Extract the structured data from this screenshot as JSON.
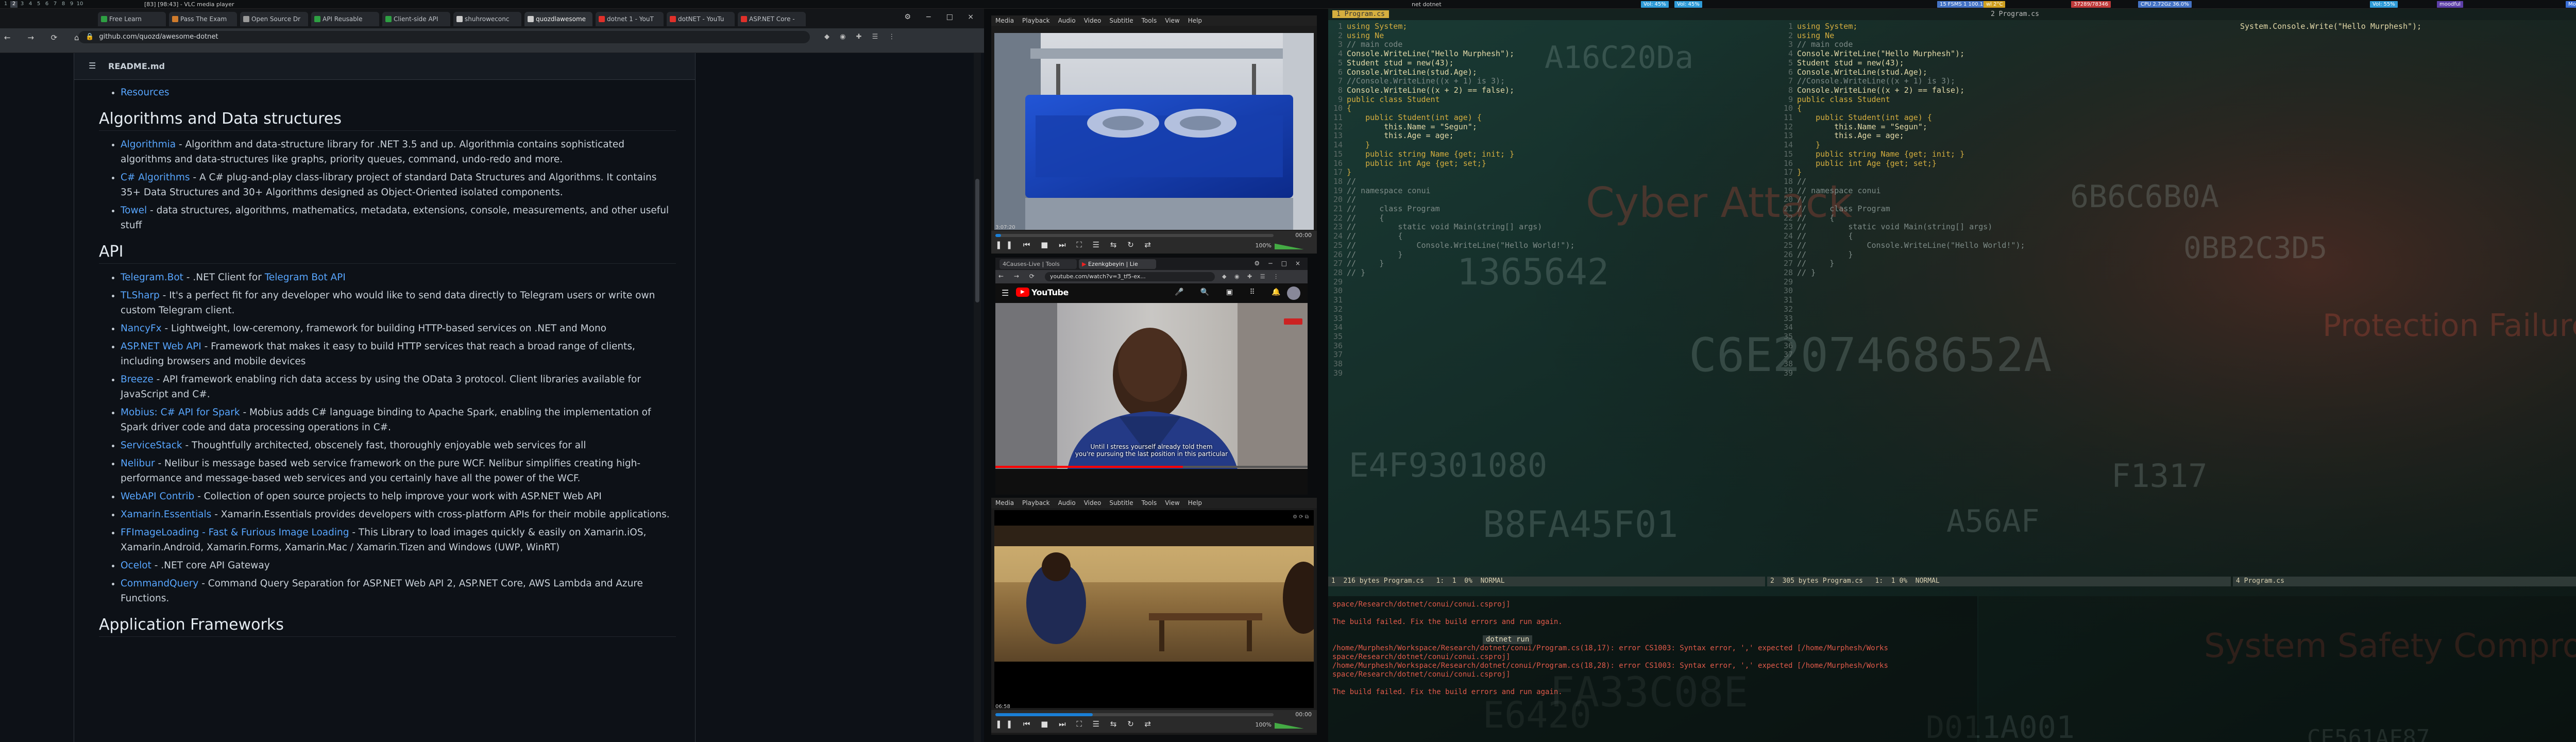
{
  "topbar": {
    "workspaces": [
      "1",
      "2",
      "3",
      "4",
      "5",
      "6",
      "7",
      "8",
      "9",
      "10"
    ],
    "active_workspace": 1,
    "window_title": "[83] [98:43] - VLC media player",
    "middle_title": "net dotnet",
    "modules": [
      {
        "text": "Vol: 45%",
        "color": "#2f9bd8"
      },
      {
        "text": "Vol: 45%",
        "color": "#2f9bd8"
      },
      {
        "text": "15 FSMS 1 100.164",
        "color": "#4573c5"
      },
      {
        "text": "wl 2°C",
        "color": "#d0a020"
      },
      {
        "text": "37289/78346",
        "color": "#c03a3a"
      },
      {
        "text": "CPU 2.72Gz 36.0%",
        "color": "#4573c5"
      },
      {
        "text": "Vol: 55%",
        "color": "#2f9bd8"
      },
      {
        "text": "moodful",
        "color": "#5d3fa8"
      },
      {
        "text": "Monday, June 07 - 09:05",
        "color": "#3a6fd6"
      }
    ]
  },
  "browser": {
    "tabs": [
      {
        "label": "Free Learn",
        "color": "#2ea043"
      },
      {
        "label": "Pass The Exam",
        "color": "#cf7b2c"
      },
      {
        "label": "Open Source Dr",
        "color": "#999999"
      },
      {
        "label": "API Reusable",
        "color": "#2ea043"
      },
      {
        "label": "Client-side API",
        "color": "#2ea043"
      },
      {
        "label": "shuhroweconc",
        "color": "#cccccc"
      },
      {
        "label": "quozdlawesome",
        "color": "#cccccc"
      },
      {
        "label": "dotnet 1 - YouT",
        "color": "#e0302a"
      },
      {
        "label": "dotNET - YouTu",
        "color": "#e0302a"
      },
      {
        "label": "ASP.NET Core -",
        "color": "#e0302a"
      }
    ],
    "active_tab": 6,
    "url": "github.com/quozd/awesome-dotnet",
    "readme_title": "README.md",
    "sections": [
      {
        "heading": "",
        "items": [
          {
            "link": "Resources",
            "text": ""
          }
        ]
      },
      {
        "heading": "Algorithms and Data structures",
        "items": [
          {
            "link": "Algorithmia",
            "text": " - Algorithm and data-structure library for .NET 3.5 and up. Algorithmia contains sophisticated algorithms and data-structures like graphs, priority queues, command, undo-redo and more."
          },
          {
            "link": "C# Algorithms",
            "text": " - A C# plug-and-play class-library project of standard Data Structures and Algorithms. It contains 35+ Data Structures and 30+ Algorithms designed as Object-Oriented isolated components."
          },
          {
            "link": "Towel",
            "text": " - data structures, algorithms, mathematics, metadata, extensions, console, measurements, and other useful stuff"
          }
        ]
      },
      {
        "heading": "API",
        "items": [
          {
            "link": "Telegram.Bot",
            "text": " - .NET Client for ",
            "link2": "Telegram Bot API",
            "text2": ""
          },
          {
            "link": "TLSharp",
            "text": " - It's a perfect fit for any developer who would like to send data directly to Telegram users or write own custom Telegram client."
          },
          {
            "link": "NancyFx",
            "text": " - Lightweight, low-ceremony, framework for building HTTP-based services on .NET and Mono"
          },
          {
            "link": "ASP.NET Web API",
            "text": " - Framework that makes it easy to build HTTP services that reach a broad range of clients, including browsers and mobile devices"
          },
          {
            "link": "Breeze",
            "text": " - API framework enabling rich data access by using the OData 3 protocol. Client libraries available for JavaScript and C#."
          },
          {
            "link": "Mobius: C# API for Spark",
            "text": " - Mobius adds C# language binding to Apache Spark, enabling the implementation of Spark driver code and data processing operations in C#."
          },
          {
            "link": "ServiceStack",
            "text": " - Thoughtfully architected, obscenely fast, thoroughly enjoyable web services for all"
          },
          {
            "link": "Nelibur",
            "text": " - Nelibur is message based web service framework on the pure WCF. Nelibur simplifies creating high-performance and message-based web services and you certainly have all the power of the WCF."
          },
          {
            "link": "WebAPI Contrib",
            "text": " - Collection of open source projects to help improve your work with ASP.NET Web API"
          },
          {
            "link": "Xamarin.Essentials",
            "text": " - Xamarin.Essentials provides developers with cross-platform APIs for their mobile applications."
          },
          {
            "link": "FFImageLoading - Fast & Furious Image Loading",
            "text": " - This Library to load images quickly & easily on Xamarin.iOS, Xamarin.Android, Xamarin.Forms, Xamarin.Mac / Xamarin.Tizen and Windows (UWP, WinRT)"
          },
          {
            "link": "Ocelot",
            "text": " - .NET core API Gateway"
          },
          {
            "link": "CommandQuery",
            "text": " - Command Query Separation for ASP.NET Web API 2, ASP.NET Core, AWS Lambda and Azure Functions."
          }
        ]
      },
      {
        "heading": "Application Frameworks",
        "items": []
      }
    ]
  },
  "vlc1": {
    "menu": [
      "Media",
      "Playback",
      "Audio",
      "Video",
      "Subtitle",
      "Tools",
      "View",
      "Help"
    ],
    "time_current": "3:07:20",
    "time_total": "00:00",
    "progress": 0.02,
    "volume": "100%"
  },
  "youtube": {
    "tabs": [
      "4Causes-Live | Tools",
      "Ezenkgbeyin | Lie"
    ],
    "url": "youtube.com/watch?v=3_tf5-ex...",
    "logo": "YouTube",
    "subtitle_line1": "Until I stress yourself already told them",
    "subtitle_line2": "you're pursuing the last position in this particular"
  },
  "vlc2": {
    "menu": [
      "Media",
      "Playback",
      "Audio",
      "Video",
      "Subtitle",
      "Tools",
      "View",
      "Help"
    ],
    "time_current": "06:58",
    "time_total": "00:00",
    "progress": 0.35,
    "volume": "100%"
  },
  "terminal": {
    "tab_left": "1 Program.cs",
    "tab_left2": "2 Program.cs",
    "left_code": [
      "using System;",
      "using Ne",
      "",
      "",
      "// main code",
      "Console.WriteLine(\"Hello Murphesh\");",
      "",
      "Student stud = new(43);",
      "Console.WriteLine(stud.Age);",
      "",
      "//Console.WriteLine((x + 1) is 3);",
      "Console.WriteLine((x + 2) == false);",
      "",
      "public class Student",
      "{",
      "    public Student(int age) {",
      "        this.Name = \"Segun\";",
      "        this.Age = age;",
      "    }",
      "    public string Name {get; init; }",
      "    public int Age {get; set;}",
      "}",
      "",
      "",
      "",
      "//",
      "// namespace conui",
      "//",
      "//     class Program",
      "//     {",
      "//         static void Main(string[] args)",
      "//         {",
      "//             Console.WriteLine(\"Hello World!\");",
      "//         }",
      "//     }",
      "// }",
      "",
      "",
      ""
    ],
    "right_code_top": "System.Console.Write(\"Hello Murphesh\");",
    "status_left": "1  216 bytes Program.cs   1:  1  0%  NORMAL",
    "status_right": "2  305 bytes Program.cs   1:  1 0%  NORMAL",
    "status_far": "4 Program.cs",
    "build_lines": [
      "space/Research/dotnet/conui/conui.csproj]",
      "",
      "The build failed. Fix the build errors and run again.",
      "",
      "dotnet run",
      "/home/Murphesh/Workspace/Research/dotnet/conui/Program.cs(18,17): error CS1003: Syntax error, ',' expected [/home/Murphesh/Works",
      "space/Research/dotnet/conui/conui.csproj]",
      "/home/Murphesh/Workspace/Research/dotnet/conui/Program.cs(18,28): error CS1003: Syntax error, ',' expected [/home/Murphesh/Works",
      "space/Research/dotnet/conui/conui.csproj]",
      "",
      "The build failed. Fix the build errors and run again."
    ],
    "bg_texts": [
      "A16C20Da",
      "Cyber Attack",
      "1365642",
      "C6E207468652A",
      "E4F9301080",
      "B8FA45F01",
      "6B6C6B0A",
      "FA33C08E",
      "Protection Failure",
      "System Safety Compromised",
      "E6420",
      "CE561AF87",
      "D011A001",
      "0BB2C3D5",
      "F1317",
      "A56AF"
    ]
  }
}
